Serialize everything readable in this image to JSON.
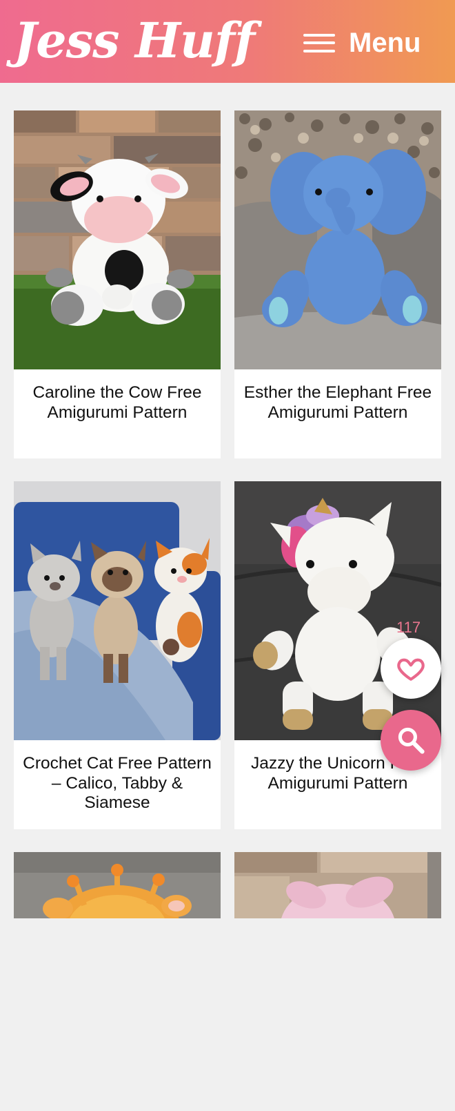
{
  "header": {
    "logo_text": "Jess Huff",
    "menu_label": "Menu"
  },
  "posts": [
    {
      "title": "Caroline the Cow Free Amigurumi Pattern",
      "image": "cow-amigurumi-photo"
    },
    {
      "title": "Esther the Elephant Free Amigurumi Pattern",
      "image": "elephant-amigurumi-photo"
    },
    {
      "title": "Crochet Cat Free Pattern – Calico, Tabby & Siamese",
      "image": "cats-amigurumi-photo"
    },
    {
      "title": "Jazzy the Unicorn Free Amigurumi Pattern",
      "image": "unicorn-amigurumi-photo"
    },
    {
      "title": "",
      "image": "giraffe-amigurumi-photo"
    },
    {
      "title": "",
      "image": "pig-amigurumi-photo"
    }
  ],
  "favorites": {
    "count": "117"
  },
  "colors": {
    "brand_pink": "#ef6b8f",
    "brand_orange": "#f09a52",
    "fab_pink": "#e9688c"
  }
}
